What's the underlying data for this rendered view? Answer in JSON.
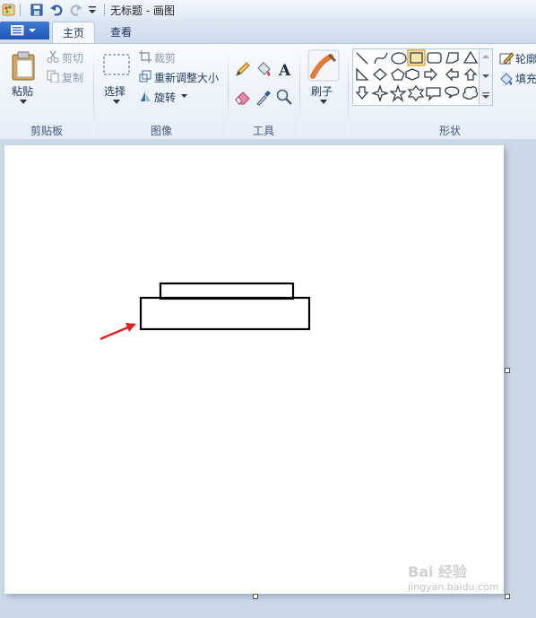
{
  "window": {
    "title": "无标题 - 画图"
  },
  "tabs": [
    {
      "label": "主页",
      "active": true
    },
    {
      "label": "查看",
      "active": false
    }
  ],
  "clipboard": {
    "paste": "粘贴",
    "cut": "剪切",
    "copy": "复制",
    "group": "剪贴板"
  },
  "image": {
    "select": "选择",
    "crop": "裁剪",
    "resize": "重新调整大小",
    "rotate": "旋转",
    "group": "图像"
  },
  "tools": {
    "group": "工具",
    "items": [
      "pencil-icon",
      "fill-bucket-icon",
      "text-icon",
      "eraser-icon",
      "color-picker-icon",
      "magnifier-icon"
    ]
  },
  "brushes": {
    "label": "刷子"
  },
  "shapes": {
    "group": "形状",
    "outline": "轮廓",
    "fill": "填充",
    "items": [
      "line",
      "curve",
      "oval",
      "rectangle",
      "rounded-rectangle",
      "polygon",
      "triangle",
      "right-triangle",
      "diamond",
      "pentagon",
      "hexagon",
      "right-arrow",
      "left-arrow",
      "up-arrow",
      "down-arrow",
      "four-point-star",
      "five-point-star",
      "six-point-star",
      "rounded-callout",
      "oval-callout",
      "cloud-callout"
    ],
    "selected": "rectangle"
  },
  "colors": {
    "ribbon_accent": "#1d56b8",
    "arrow": "#e02020",
    "stroke": "#000000"
  },
  "watermark": {
    "text": "jingyan.baidu.com",
    "logo": "Bai 经验"
  }
}
